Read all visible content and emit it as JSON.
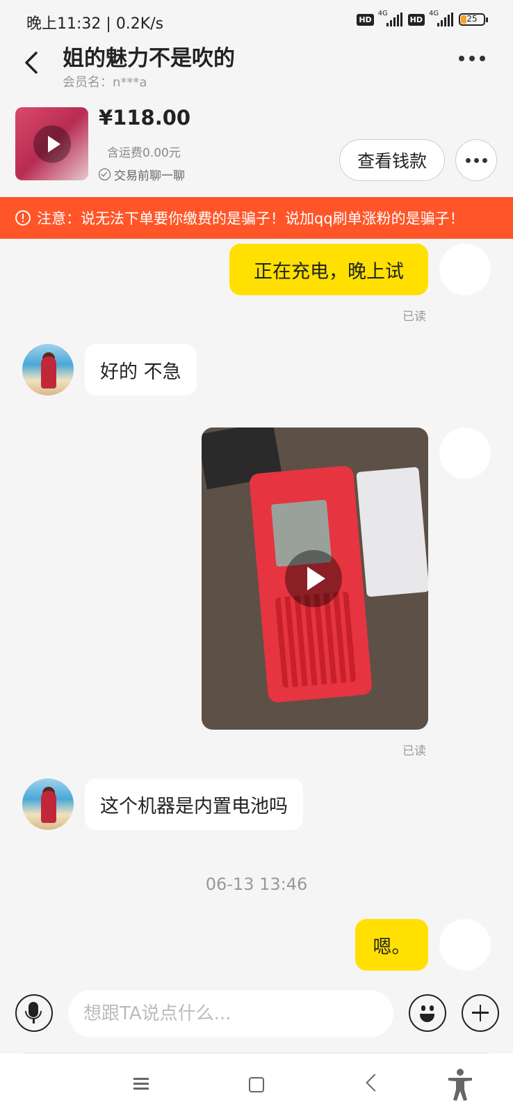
{
  "status_bar": {
    "time": "晚上11:32",
    "speed": "0.2K/s",
    "sim1_hd": "HD",
    "sim1_net": "4G",
    "sim2_hd": "HD",
    "sim2_net": "4G",
    "battery": "25"
  },
  "header": {
    "title": "姐的魅力不是吹的",
    "member_name": "会员名：n***a"
  },
  "product": {
    "price": "¥118.00",
    "shipping": "含运费0.00元",
    "chat_first": "交易前聊一聊",
    "view_payment_label": "查看钱款"
  },
  "warning": {
    "text": "注意：说无法下单要你缴费的是骗子！说加qq刷单涨粉的是骗子！"
  },
  "messages": [
    {
      "sender": "me",
      "type": "text",
      "text": "正在充电，晚上试",
      "read_label": "已读"
    },
    {
      "sender": "other",
      "type": "text",
      "text": "好的 不急"
    },
    {
      "sender": "me",
      "type": "video",
      "read_label": "已读"
    },
    {
      "sender": "other",
      "type": "text",
      "text": "这个机器是内置电池吗"
    },
    {
      "sender": "me",
      "type": "text",
      "text": "嗯。"
    }
  ],
  "timestamp": "06-13 13:46",
  "input": {
    "placeholder": "想跟TA说点什么..."
  },
  "colors": {
    "accent_bubble": "#ffe000",
    "warning_bg": "#ff5528",
    "background": "#f5f5f5"
  },
  "icons": [
    "back-icon",
    "more-icon",
    "play-icon",
    "check-circle-icon",
    "warning-icon",
    "mic-icon",
    "emoji-icon",
    "plus-icon",
    "menu-icon",
    "home-icon",
    "nav-back-icon",
    "accessibility-icon"
  ]
}
